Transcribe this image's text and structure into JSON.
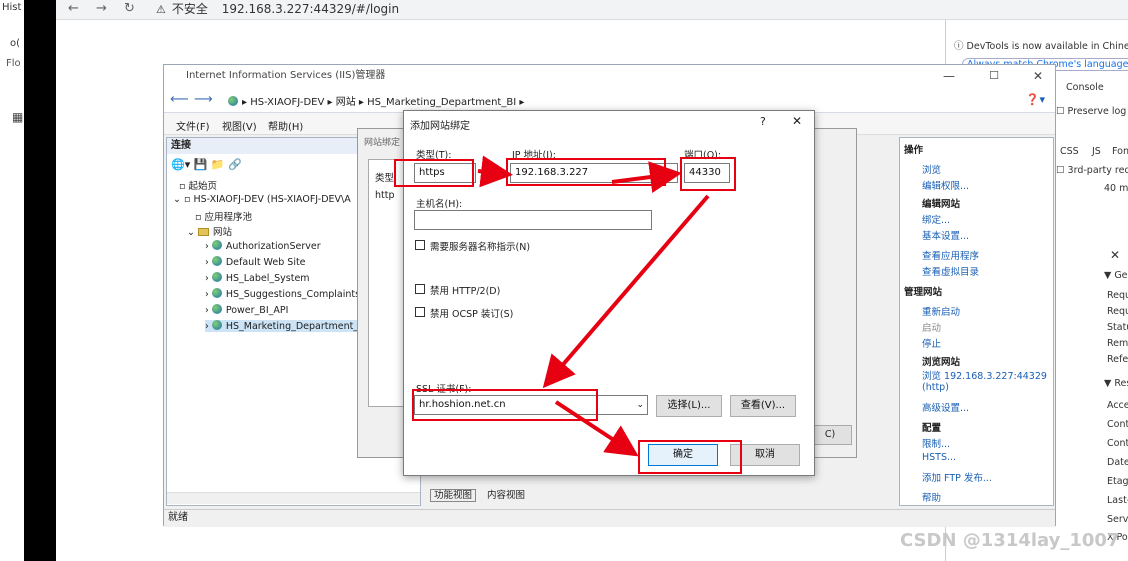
{
  "browser": {
    "history_label": "Hist",
    "left_frag1": "o(",
    "left_frag2": "Flo",
    "insecure": "不安全",
    "url": "192.168.3.227:44329/#/login"
  },
  "devtools": {
    "notice": "DevTools is now available in Chinese",
    "match_lang": "Always match Chrome's language",
    "console_tab": "Console",
    "preserve_log": "Preserve log",
    "filter_css": "CSS",
    "filter_js": "JS",
    "filter_font": "Fon",
    "third_party": "3rd-party requ",
    "time": "40 ms",
    "close": "✕",
    "section_general": "▼ Gen",
    "req1": "Requ",
    "req2": "Requ",
    "status": "Statu",
    "remote": "Remo",
    "referrer": "Refer",
    "section_response": "▼ Res",
    "accept": "Acce",
    "content1": "Cont",
    "content2": "Cont",
    "date": "Date",
    "etag": "Etag",
    "lastmod": "Last-",
    "server": "Serv",
    "xpow": "X-Po"
  },
  "iis": {
    "title": "Internet Information Services (IIS)管理器",
    "crumbs": [
      "HS-XIAOFJ-DEV",
      "网站",
      "HS_Marketing_Department_BI"
    ],
    "menu": [
      "文件(F)",
      "视图(V)",
      "帮助(H)"
    ],
    "conn_header": "连接",
    "tree": {
      "start": "起始页",
      "server": "HS-XIAOFJ-DEV (HS-XIAOFJ-DEV\\A",
      "apppools": "应用程序池",
      "sites": "网站",
      "site_items": [
        "AuthorizationServer",
        "Default Web Site",
        "HS_Label_System",
        "HS_Suggestions_Complaints_",
        "Power_BI_API",
        "HS_Marketing_Department_B"
      ]
    },
    "actions_header": "操作",
    "actions": {
      "browse": "浏览",
      "edit_perm": "编辑权限...",
      "edit_site": "编辑网站",
      "bindings": "绑定...",
      "basic_settings": "基本设置...",
      "view_apps": "查看应用程序",
      "view_vdirs": "查看虚拟目录",
      "manage_site": "管理网站",
      "restart": "重新启动",
      "start": "启动",
      "stop": "停止",
      "browse_site": "浏览网站",
      "browse_link": "浏览 192.168.3.227:44329",
      "browse_proto": "(http)",
      "advanced": "高级设置...",
      "config": "配置",
      "limits": "限制...",
      "hsts": "HSTS...",
      "add_ftp": "添加 FTP 发布...",
      "help": "帮助"
    },
    "status": "就绪",
    "view_tabs": [
      "功能视图",
      "内容视图"
    ]
  },
  "bg_dialog": {
    "title": "网站绑定",
    "col_type": "类型",
    "row_type": "http",
    "close_btn": "C)"
  },
  "dialog": {
    "title": "添加网站绑定",
    "help": "?",
    "close": "✕",
    "type_label": "类型(T):",
    "type_value": "https",
    "ip_label": "IP 地址(I):",
    "ip_value": "192.168.3.227",
    "port_label": "端口(O):",
    "port_value": "44330",
    "host_label": "主机名(H):",
    "host_value": "",
    "sni_label": "需要服务器名称指示(N)",
    "http2_label": "禁用 HTTP/2(D)",
    "ocsp_label": "禁用 OCSP 装订(S)",
    "ssl_label": "SSL 证书(F):",
    "ssl_value": "hr.hoshion.net.cn",
    "select_btn": "选择(L)...",
    "view_btn": "查看(V)...",
    "ok_btn": "确定",
    "cancel_btn": "取消"
  },
  "watermark": "CSDN @1314lay_1007",
  "annotation_color": "#e60012"
}
